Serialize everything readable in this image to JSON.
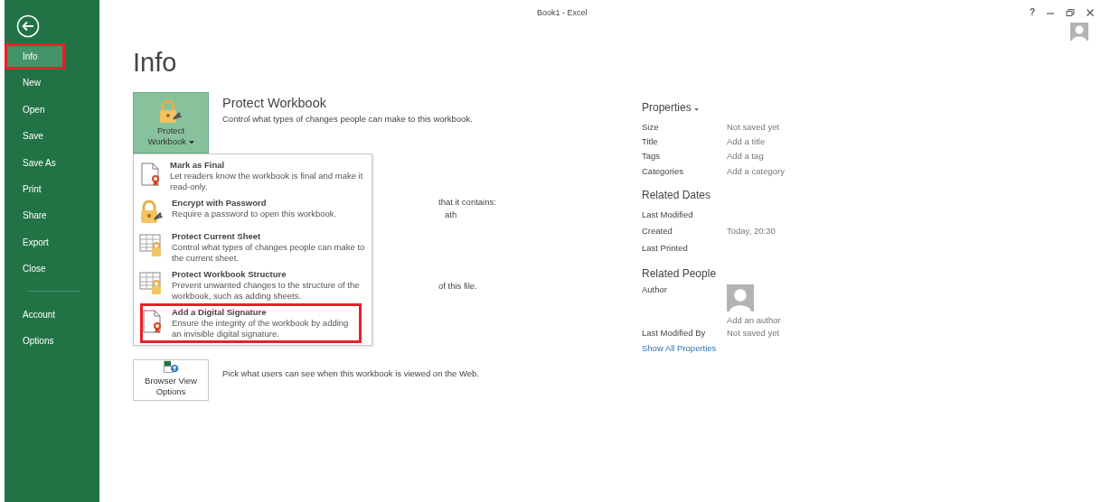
{
  "window": {
    "title": "Book1 - Excel",
    "help": "?"
  },
  "sidebar": {
    "items": [
      {
        "label": "Info",
        "selected": true,
        "highlighted": true
      },
      {
        "label": "New",
        "selected": false,
        "highlighted": false
      },
      {
        "label": "Open",
        "selected": false,
        "highlighted": false
      },
      {
        "label": "Save",
        "selected": false,
        "highlighted": false
      },
      {
        "label": "Save As",
        "selected": false,
        "highlighted": false
      },
      {
        "label": "Print",
        "selected": false,
        "highlighted": false
      },
      {
        "label": "Share",
        "selected": false,
        "highlighted": false
      },
      {
        "label": "Export",
        "selected": false,
        "highlighted": false
      },
      {
        "label": "Close",
        "selected": false,
        "highlighted": false
      }
    ],
    "bottom_items": [
      {
        "label": "Account",
        "selected": false,
        "highlighted": false
      },
      {
        "label": "Options",
        "selected": false,
        "highlighted": false
      }
    ]
  },
  "page_title": "Info",
  "protect": {
    "button_label": "Protect Workbook",
    "heading": "Protect Workbook",
    "description": "Control what types of changes people can make to this workbook.",
    "expanded": true
  },
  "menu": [
    {
      "kind": "ribbon-doc",
      "title": "Mark as Final",
      "description": "Let readers know the workbook is final and make it read-only.",
      "highlighted": false
    },
    {
      "kind": "lock",
      "title": "Encrypt with Password",
      "description": "Require a password to open this workbook.",
      "highlighted": false
    },
    {
      "kind": "sheet-lock",
      "title": "Protect Current Sheet",
      "description": "Control what types of changes people can make to the current sheet.",
      "highlighted": false
    },
    {
      "kind": "sheet-lock",
      "title": "Protect Workbook Structure",
      "description": "Prevent unwanted changes to the structure of the workbook, such as adding sheets.",
      "highlighted": false
    },
    {
      "kind": "ribbon-doc",
      "title": "Add a Digital Signature",
      "description": "Ensure the integrity of the workbook by adding an invisible digital signature.",
      "highlighted": true
    }
  ],
  "covered_texts": [
    {
      "text": "that it contains:"
    },
    {
      "text": "ath"
    },
    {
      "text": "of this file."
    }
  ],
  "browser_view": {
    "button_label": "Browser View Options",
    "description": "Pick what users can see when this workbook is viewed on the Web."
  },
  "properties": {
    "heading": "Properties",
    "rows": [
      {
        "label": "Size",
        "value": "Not saved yet"
      },
      {
        "label": "Title",
        "value": "Add a title"
      },
      {
        "label": "Tags",
        "value": "Add a tag"
      },
      {
        "label": "Categories",
        "value": "Add a category"
      }
    ]
  },
  "related_dates": {
    "heading": "Related Dates",
    "rows": [
      {
        "label": "Last Modified",
        "value": ""
      },
      {
        "label": "Created",
        "value": "Today, 20:30"
      },
      {
        "label": "Last Printed",
        "value": ""
      }
    ]
  },
  "related_people": {
    "heading": "Related People",
    "author_label": "Author",
    "author_placeholder": "Add an author",
    "last_modified_label": "Last Modified By",
    "last_modified_value": "Not saved yet"
  },
  "show_all": "Show All Properties"
}
